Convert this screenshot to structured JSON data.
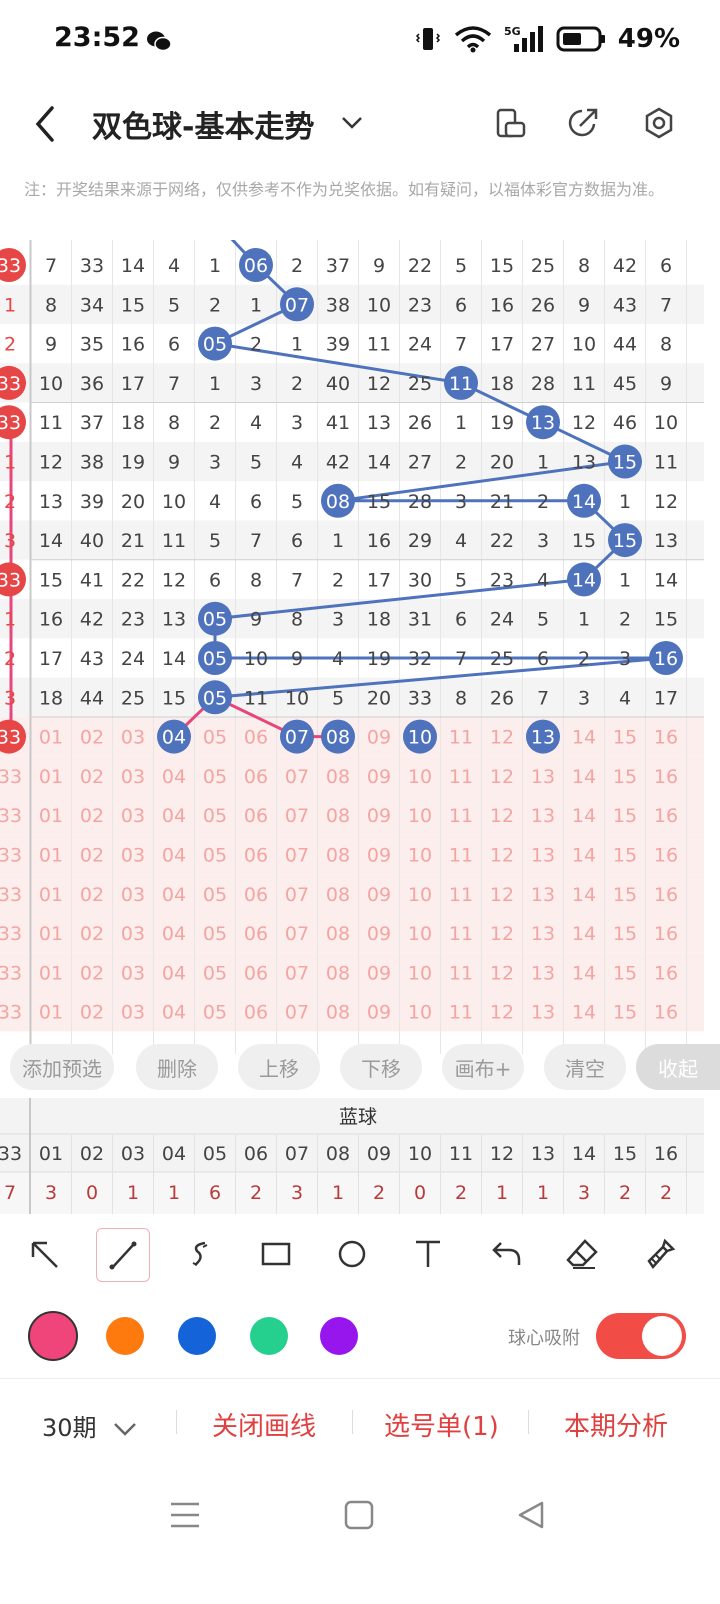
{
  "status": {
    "time": "23:52",
    "battery": "49%",
    "network": "5G"
  },
  "header": {
    "title": "双色球-基本走势"
  },
  "icons": {
    "header_right": [
      "portrait-landscape-icon",
      "share-icon",
      "settings-icon"
    ]
  },
  "note": "注：开奖结果来源于网络，仅供参考不作为兑奖依据。如有疑问，以福体彩官方数据为准。",
  "grid": {
    "left_edge": [
      "33",
      "1",
      "2",
      "33",
      "33",
      "1",
      "2",
      "3",
      "33",
      "1",
      "2",
      "3",
      "33",
      "33",
      "33",
      "33",
      "33",
      "33",
      "33",
      "33"
    ],
    "rows": [
      [
        "7",
        "33",
        "14",
        "4",
        "1",
        "06",
        "2",
        "37",
        "9",
        "22",
        "5",
        "15",
        "25",
        "8",
        "42",
        "6"
      ],
      [
        "8",
        "34",
        "15",
        "5",
        "2",
        "1",
        "07",
        "38",
        "10",
        "23",
        "6",
        "16",
        "26",
        "9",
        "43",
        "7"
      ],
      [
        "9",
        "35",
        "16",
        "6",
        "05",
        "2",
        "1",
        "39",
        "11",
        "24",
        "7",
        "17",
        "27",
        "10",
        "44",
        "8"
      ],
      [
        "10",
        "36",
        "17",
        "7",
        "1",
        "3",
        "2",
        "40",
        "12",
        "25",
        "11",
        "18",
        "28",
        "11",
        "45",
        "9"
      ],
      [
        "11",
        "37",
        "18",
        "8",
        "2",
        "4",
        "3",
        "41",
        "13",
        "26",
        "1",
        "19",
        "13",
        "12",
        "46",
        "10"
      ],
      [
        "12",
        "38",
        "19",
        "9",
        "3",
        "5",
        "4",
        "42",
        "14",
        "27",
        "2",
        "20",
        "1",
        "13",
        "15",
        "11"
      ],
      [
        "13",
        "39",
        "20",
        "10",
        "4",
        "6",
        "5",
        "08",
        "15",
        "28",
        "3",
        "21",
        "2",
        "14",
        "1",
        "12"
      ],
      [
        "14",
        "40",
        "21",
        "11",
        "5",
        "7",
        "6",
        "1",
        "16",
        "29",
        "4",
        "22",
        "3",
        "15",
        "15",
        "13"
      ],
      [
        "15",
        "41",
        "22",
        "12",
        "6",
        "8",
        "7",
        "2",
        "17",
        "30",
        "5",
        "23",
        "4",
        "14",
        "1",
        "14"
      ],
      [
        "16",
        "42",
        "23",
        "13",
        "05",
        "9",
        "8",
        "3",
        "18",
        "31",
        "6",
        "24",
        "5",
        "1",
        "2",
        "15"
      ],
      [
        "17",
        "43",
        "24",
        "14",
        "05",
        "10",
        "9",
        "4",
        "19",
        "32",
        "7",
        "25",
        "6",
        "2",
        "3",
        "16"
      ],
      [
        "18",
        "44",
        "25",
        "15",
        "05",
        "11",
        "10",
        "5",
        "20",
        "33",
        "8",
        "26",
        "7",
        "3",
        "4",
        "17"
      ],
      [
        "01",
        "02",
        "03",
        "04",
        "05",
        "06",
        "07",
        "08",
        "09",
        "10",
        "11",
        "12",
        "13",
        "14",
        "15",
        "16"
      ],
      [
        "01",
        "02",
        "03",
        "04",
        "05",
        "06",
        "07",
        "08",
        "09",
        "10",
        "11",
        "12",
        "13",
        "14",
        "15",
        "16"
      ],
      [
        "01",
        "02",
        "03",
        "04",
        "05",
        "06",
        "07",
        "08",
        "09",
        "10",
        "11",
        "12",
        "13",
        "14",
        "15",
        "16"
      ],
      [
        "01",
        "02",
        "03",
        "04",
        "05",
        "06",
        "07",
        "08",
        "09",
        "10",
        "11",
        "12",
        "13",
        "14",
        "15",
        "16"
      ],
      [
        "01",
        "02",
        "03",
        "04",
        "05",
        "06",
        "07",
        "08",
        "09",
        "10",
        "11",
        "12",
        "13",
        "14",
        "15",
        "16"
      ],
      [
        "01",
        "02",
        "03",
        "04",
        "05",
        "06",
        "07",
        "08",
        "09",
        "10",
        "11",
        "12",
        "13",
        "14",
        "15",
        "16"
      ],
      [
        "01",
        "02",
        "03",
        "04",
        "05",
        "06",
        "07",
        "08",
        "09",
        "10",
        "11",
        "12",
        "13",
        "14",
        "15",
        "16"
      ],
      [
        "01",
        "02",
        "03",
        "04",
        "05",
        "06",
        "07",
        "08",
        "09",
        "10",
        "11",
        "12",
        "13",
        "14",
        "15",
        "16"
      ]
    ]
  },
  "actions": [
    "添加预选",
    "删除",
    "上移",
    "下移",
    "画布+",
    "清空",
    "收起"
  ],
  "blue_stats": {
    "title": "蓝球",
    "left_edge": [
      "33",
      "7"
    ],
    "numbers": [
      "01",
      "02",
      "03",
      "04",
      "05",
      "06",
      "07",
      "08",
      "09",
      "10",
      "11",
      "12",
      "13",
      "14",
      "15",
      "16"
    ],
    "counts": [
      "3",
      "0",
      "1",
      "1",
      "6",
      "2",
      "3",
      "1",
      "2",
      "0",
      "2",
      "1",
      "1",
      "3",
      "2",
      "2"
    ]
  },
  "tools": [
    "select-arrow-icon",
    "line-icon",
    "freehand-icon",
    "rectangle-icon",
    "circle-icon",
    "text-icon",
    "undo-icon",
    "eraser-icon",
    "clear-brush-icon"
  ],
  "colors": [
    "#f0457b",
    "#ff7a0e",
    "#1463d8",
    "#25d08f",
    "#9716ee"
  ],
  "snap": {
    "label": "球心吸附",
    "on": true
  },
  "bottom": {
    "period": "30期",
    "close_lines": "关闭画线",
    "ticket": "选号单(1)",
    "analysis": "本期分析"
  },
  "theme": {
    "red": "#e64646",
    "blue_ball": "#4f72bd",
    "pink_line": "#e8457b",
    "light_red_text": "#f3a5a2"
  }
}
